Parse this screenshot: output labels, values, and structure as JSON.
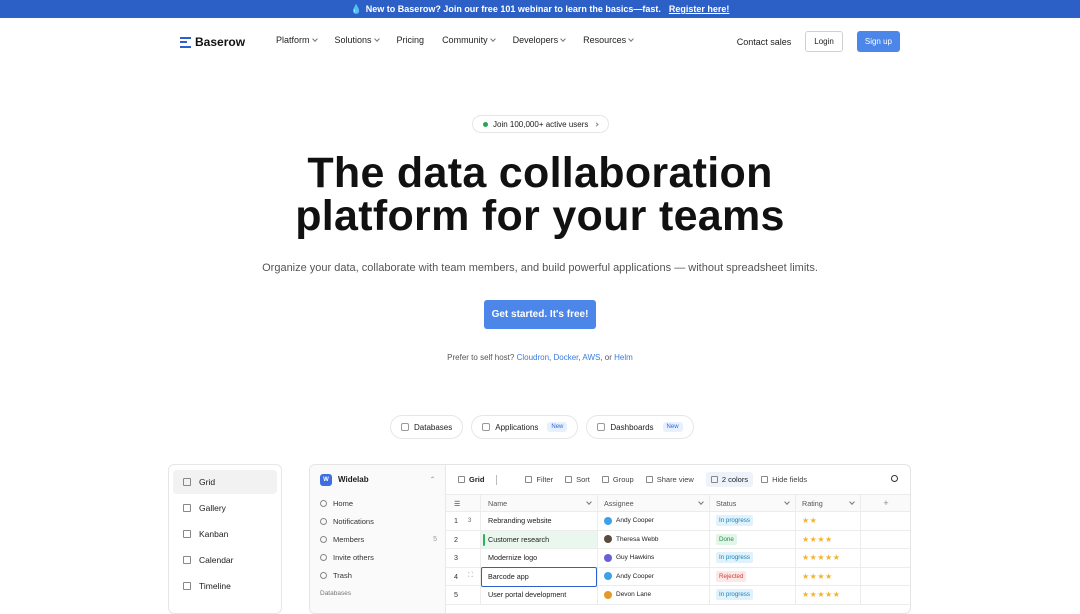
{
  "banner": {
    "icon": "💧",
    "text": "New to Baserow? Join our free 101 webinar to learn the basics—fast.",
    "cta": "Register here!"
  },
  "nav": {
    "logo": "Baserow",
    "links": [
      "Platform",
      "Solutions",
      "Pricing",
      "Community",
      "Developers",
      "Resources"
    ],
    "has_chevron": [
      true,
      true,
      false,
      true,
      true,
      true
    ],
    "contact": "Contact sales",
    "login": "Login",
    "signup": "Sign up"
  },
  "pill": "Join 100,000+ active users",
  "hero": {
    "line1": "The data collaboration",
    "line2": "platform for your teams"
  },
  "subtitle": "Organize your data, collaborate with team members, and build powerful applications — without spreadsheet limits.",
  "cta": "Get started. It's free!",
  "selfhost": {
    "prefix": "Prefer to self host?",
    "links": [
      "Cloudron",
      "Docker",
      "AWS",
      "Helm"
    ],
    "sep1": ",",
    "sep2": ",",
    "sep3": ", or"
  },
  "product_tabs": [
    {
      "label": "Databases",
      "new": ""
    },
    {
      "label": "Applications",
      "new": "New"
    },
    {
      "label": "Dashboards",
      "new": "New"
    }
  ],
  "views": [
    "Grid",
    "Gallery",
    "Kanban",
    "Calendar",
    "Timeline"
  ],
  "workspace": {
    "badge": "W",
    "name": "Widelab"
  },
  "sidebar": [
    {
      "label": "Home",
      "count": ""
    },
    {
      "label": "Notifications",
      "count": ""
    },
    {
      "label": "Members",
      "count": "5"
    },
    {
      "label": "Invite others",
      "count": ""
    },
    {
      "label": "Trash",
      "count": ""
    }
  ],
  "sidebar_section": "Databases",
  "toolbar": {
    "view": "Grid",
    "filter": "Filter",
    "sort": "Sort",
    "group": "Group",
    "share": "Share view",
    "colors": "2 colors",
    "hide": "Hide fields"
  },
  "columns": {
    "name": "Name",
    "assignee": "Assignee",
    "status": "Status",
    "rating": "Rating"
  },
  "rows": [
    {
      "n": "1",
      "count": "3",
      "name": "Rebranding website",
      "assignee": "Andy Cooper",
      "avatar": "#3ea0e6",
      "status": "In progress",
      "status_bg": "#e0f2fb",
      "status_fg": "#1b82b8",
      "rating": "★★"
    },
    {
      "n": "2",
      "count": "",
      "name": "Customer research",
      "assignee": "Theresa Webb",
      "avatar": "#5a4b3c",
      "status": "Done",
      "status_bg": "#e2f6e8",
      "status_fg": "#228a49",
      "rating": "★★★★"
    },
    {
      "n": "3",
      "count": "",
      "name": "Modernize logo",
      "assignee": "Guy Hawkins",
      "avatar": "#6b5fd6",
      "status": "In progress",
      "status_bg": "#e0f2fb",
      "status_fg": "#1b82b8",
      "rating": "★★★★★"
    },
    {
      "n": "4",
      "count": "",
      "name": "Barcode app",
      "assignee": "Andy Cooper",
      "avatar": "#3ea0e6",
      "status": "Rejected",
      "status_bg": "#fde7e7",
      "status_fg": "#d0413a",
      "rating": "★★★★"
    },
    {
      "n": "5",
      "count": "",
      "name": "User portal development",
      "assignee": "Devon Lane",
      "avatar": "#e39a2b",
      "status": "In progress",
      "status_bg": "#e0f2fb",
      "status_fg": "#1b82b8",
      "rating": "★★★★★"
    }
  ],
  "add_column": "+"
}
